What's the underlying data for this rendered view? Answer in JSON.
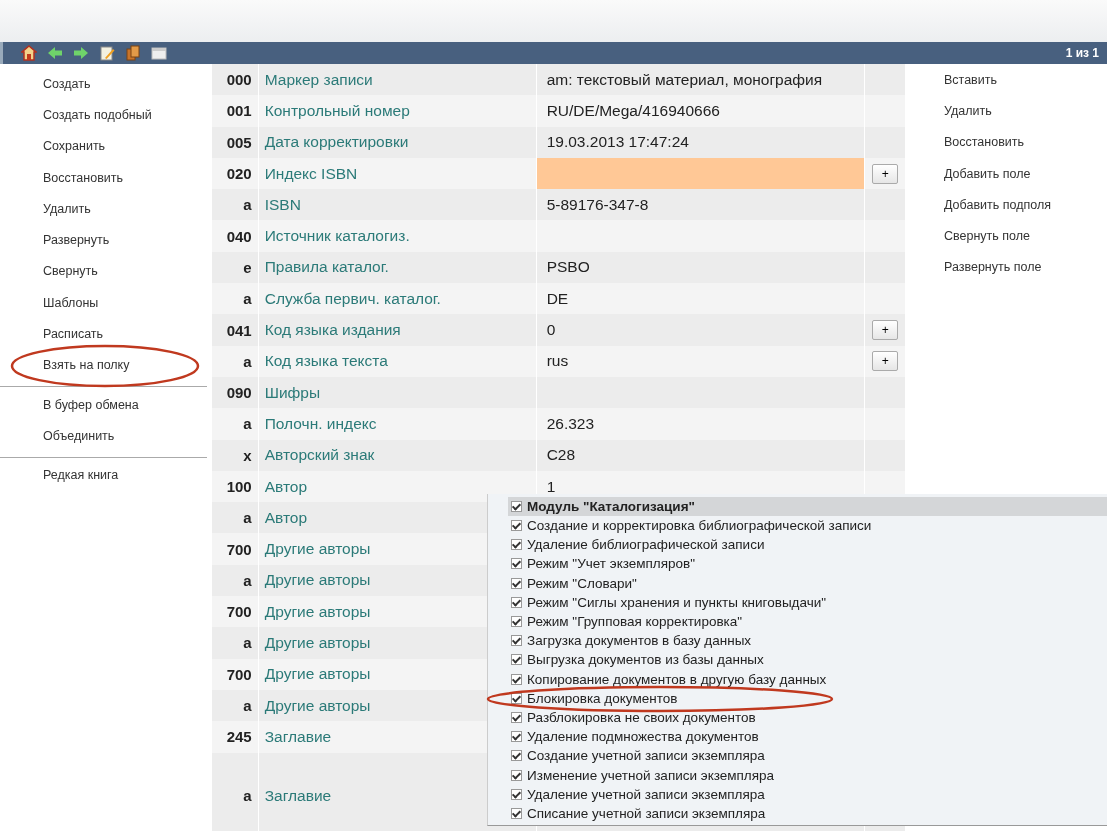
{
  "toolbar": {
    "pager": "1 из 1"
  },
  "left_menu": [
    {
      "items": [
        {
          "label": "Создать"
        },
        {
          "label": "Создать подобный"
        },
        {
          "label": "Сохранить"
        },
        {
          "label": "Восстановить"
        },
        {
          "label": "Удалить"
        },
        {
          "label": "Развернуть"
        },
        {
          "label": "Свернуть"
        },
        {
          "label": "Шаблоны"
        },
        {
          "label": "Расписать"
        },
        {
          "label": "Взять на полку",
          "circled": true
        }
      ]
    },
    {
      "items": [
        {
          "label": "В буфер обмена"
        },
        {
          "label": "Объединить"
        }
      ]
    },
    {
      "items": [
        {
          "label": "Редкая книга"
        }
      ]
    }
  ],
  "record": [
    {
      "code": "000",
      "label": "Маркер записи",
      "value": "am: текстовый материал, монография"
    },
    {
      "code": "001",
      "label": "Контрольный номер",
      "value": "RU/DE/Mega/416940666"
    },
    {
      "code": "005",
      "label": "Дата корректировки",
      "value": "19.03.2013 17:47:24"
    },
    {
      "code": "020",
      "label": "Индекс ISBN",
      "highlighted": true,
      "plus": "+"
    },
    {
      "code": "a",
      "label": "ISBN",
      "value": "5-89176-347-8"
    },
    {
      "code": "040",
      "label": "Источник каталогиз."
    },
    {
      "code": "e",
      "label": "Правила каталог.",
      "value": "PSBO"
    },
    {
      "code": "a",
      "label": "Служба первич. каталог.",
      "value": "DE"
    },
    {
      "code": "041",
      "label": "Код языка издания",
      "value": "0",
      "plus": "+"
    },
    {
      "code": "a",
      "label": "Код языка текста",
      "value": "rus",
      "plus": "+"
    },
    {
      "code": "090",
      "label": "Шифры"
    },
    {
      "code": "a",
      "label": "Полочн. индекс",
      "value": "26.323"
    },
    {
      "code": "x",
      "label": "Авторский знак",
      "value": "C28"
    },
    {
      "code": "100",
      "label": "Автор",
      "value": "1"
    },
    {
      "code": "a",
      "label": "Автор"
    },
    {
      "code": "700",
      "label": "Другие авторы"
    },
    {
      "code": "a",
      "label": "Другие авторы"
    },
    {
      "code": "700",
      "label": "Другие авторы"
    },
    {
      "code": "a",
      "label": "Другие авторы"
    },
    {
      "code": "700",
      "label": "Другие авторы"
    },
    {
      "code": "a",
      "label": "Другие авторы"
    },
    {
      "code": "245",
      "label": "Заглавие"
    },
    {
      "code": "a",
      "label": "Заглавие",
      "tall": true
    }
  ],
  "right_menu": [
    "Вставить",
    "Удалить",
    "Восстановить",
    "Добавить поле",
    "Добавить подполя",
    "Свернуть поле",
    "Развернуть поле"
  ],
  "permissions": {
    "header": {
      "label": "Модуль \"Каталогизация\"",
      "checked": true
    },
    "items": [
      {
        "label": "Создание и корректировка библиографической записи",
        "checked": true
      },
      {
        "label": "Удаление библиографической записи",
        "checked": true
      },
      {
        "label": "Режим \"Учет экземпляров\"",
        "checked": true
      },
      {
        "label": "Режим \"Словари\"",
        "checked": true
      },
      {
        "label": "Режим \"Сиглы хранения и пункты книговыдачи\"",
        "checked": true
      },
      {
        "label": "Режим \"Групповая корректировка\"",
        "checked": true
      },
      {
        "label": "Загрузка документов в базу данных",
        "checked": true
      },
      {
        "label": "Выгрузка документов из базы данных",
        "checked": true
      },
      {
        "label": "Копирование документов в другую базу данных",
        "checked": true
      },
      {
        "label": "Блокировка документов",
        "checked": true,
        "circled": true
      },
      {
        "label": "Разблокировка не своих документов",
        "checked": true
      },
      {
        "label": "Удаление подмножества документов",
        "checked": true
      },
      {
        "label": "Создание учетной записи экземпляра",
        "checked": true
      },
      {
        "label": "Изменение учетной записи экземпляра",
        "checked": true
      },
      {
        "label": "Удаление учетной записи экземпляра",
        "checked": true
      },
      {
        "label": "Списание учетной записи экземпляра",
        "checked": true
      }
    ]
  }
}
